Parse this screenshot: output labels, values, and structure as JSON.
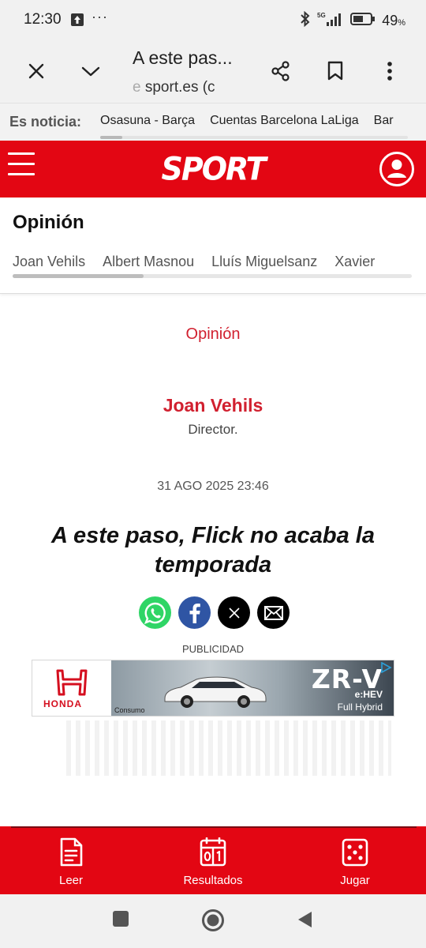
{
  "status_bar": {
    "time": "12:30",
    "dots": "···",
    "network": "5G",
    "battery": "49",
    "battery_unit": "%"
  },
  "browser": {
    "title": "A este pas...",
    "url_prefix": "e",
    "url": " sport.es (c"
  },
  "trending": {
    "label": "Es noticia:",
    "items": [
      "Osasuna - Barça",
      "Cuentas Barcelona LaLiga",
      "Bar"
    ]
  },
  "header": {
    "logo": "SPORT"
  },
  "section_nav": {
    "title": "Opinión",
    "authors": [
      "Joan Vehils",
      "Albert Masnou",
      "Lluís Miguelsanz",
      "Xavier"
    ]
  },
  "article": {
    "kicker": "Opinión",
    "author_name": "Joan Vehils",
    "author_role": "Director.",
    "date": "31 AGO 2025 23:46",
    "headline": "A este paso, Flick no acaba la temporada"
  },
  "ad": {
    "label": "PUBLICIDAD",
    "brand": "HONDA",
    "model": "ZR-V",
    "badge": "e:HEV",
    "subtitle": "Full Hybrid",
    "consumo": "Consumo"
  },
  "bottom_nav": {
    "items": [
      {
        "label": "Leer",
        "icon": "document-icon"
      },
      {
        "label": "Resultados",
        "icon": "scoreboard-icon"
      },
      {
        "label": "Jugar",
        "icon": "dice-icon"
      }
    ]
  },
  "colors": {
    "brand_red": "#e30613",
    "accent_red": "#d1202f"
  }
}
